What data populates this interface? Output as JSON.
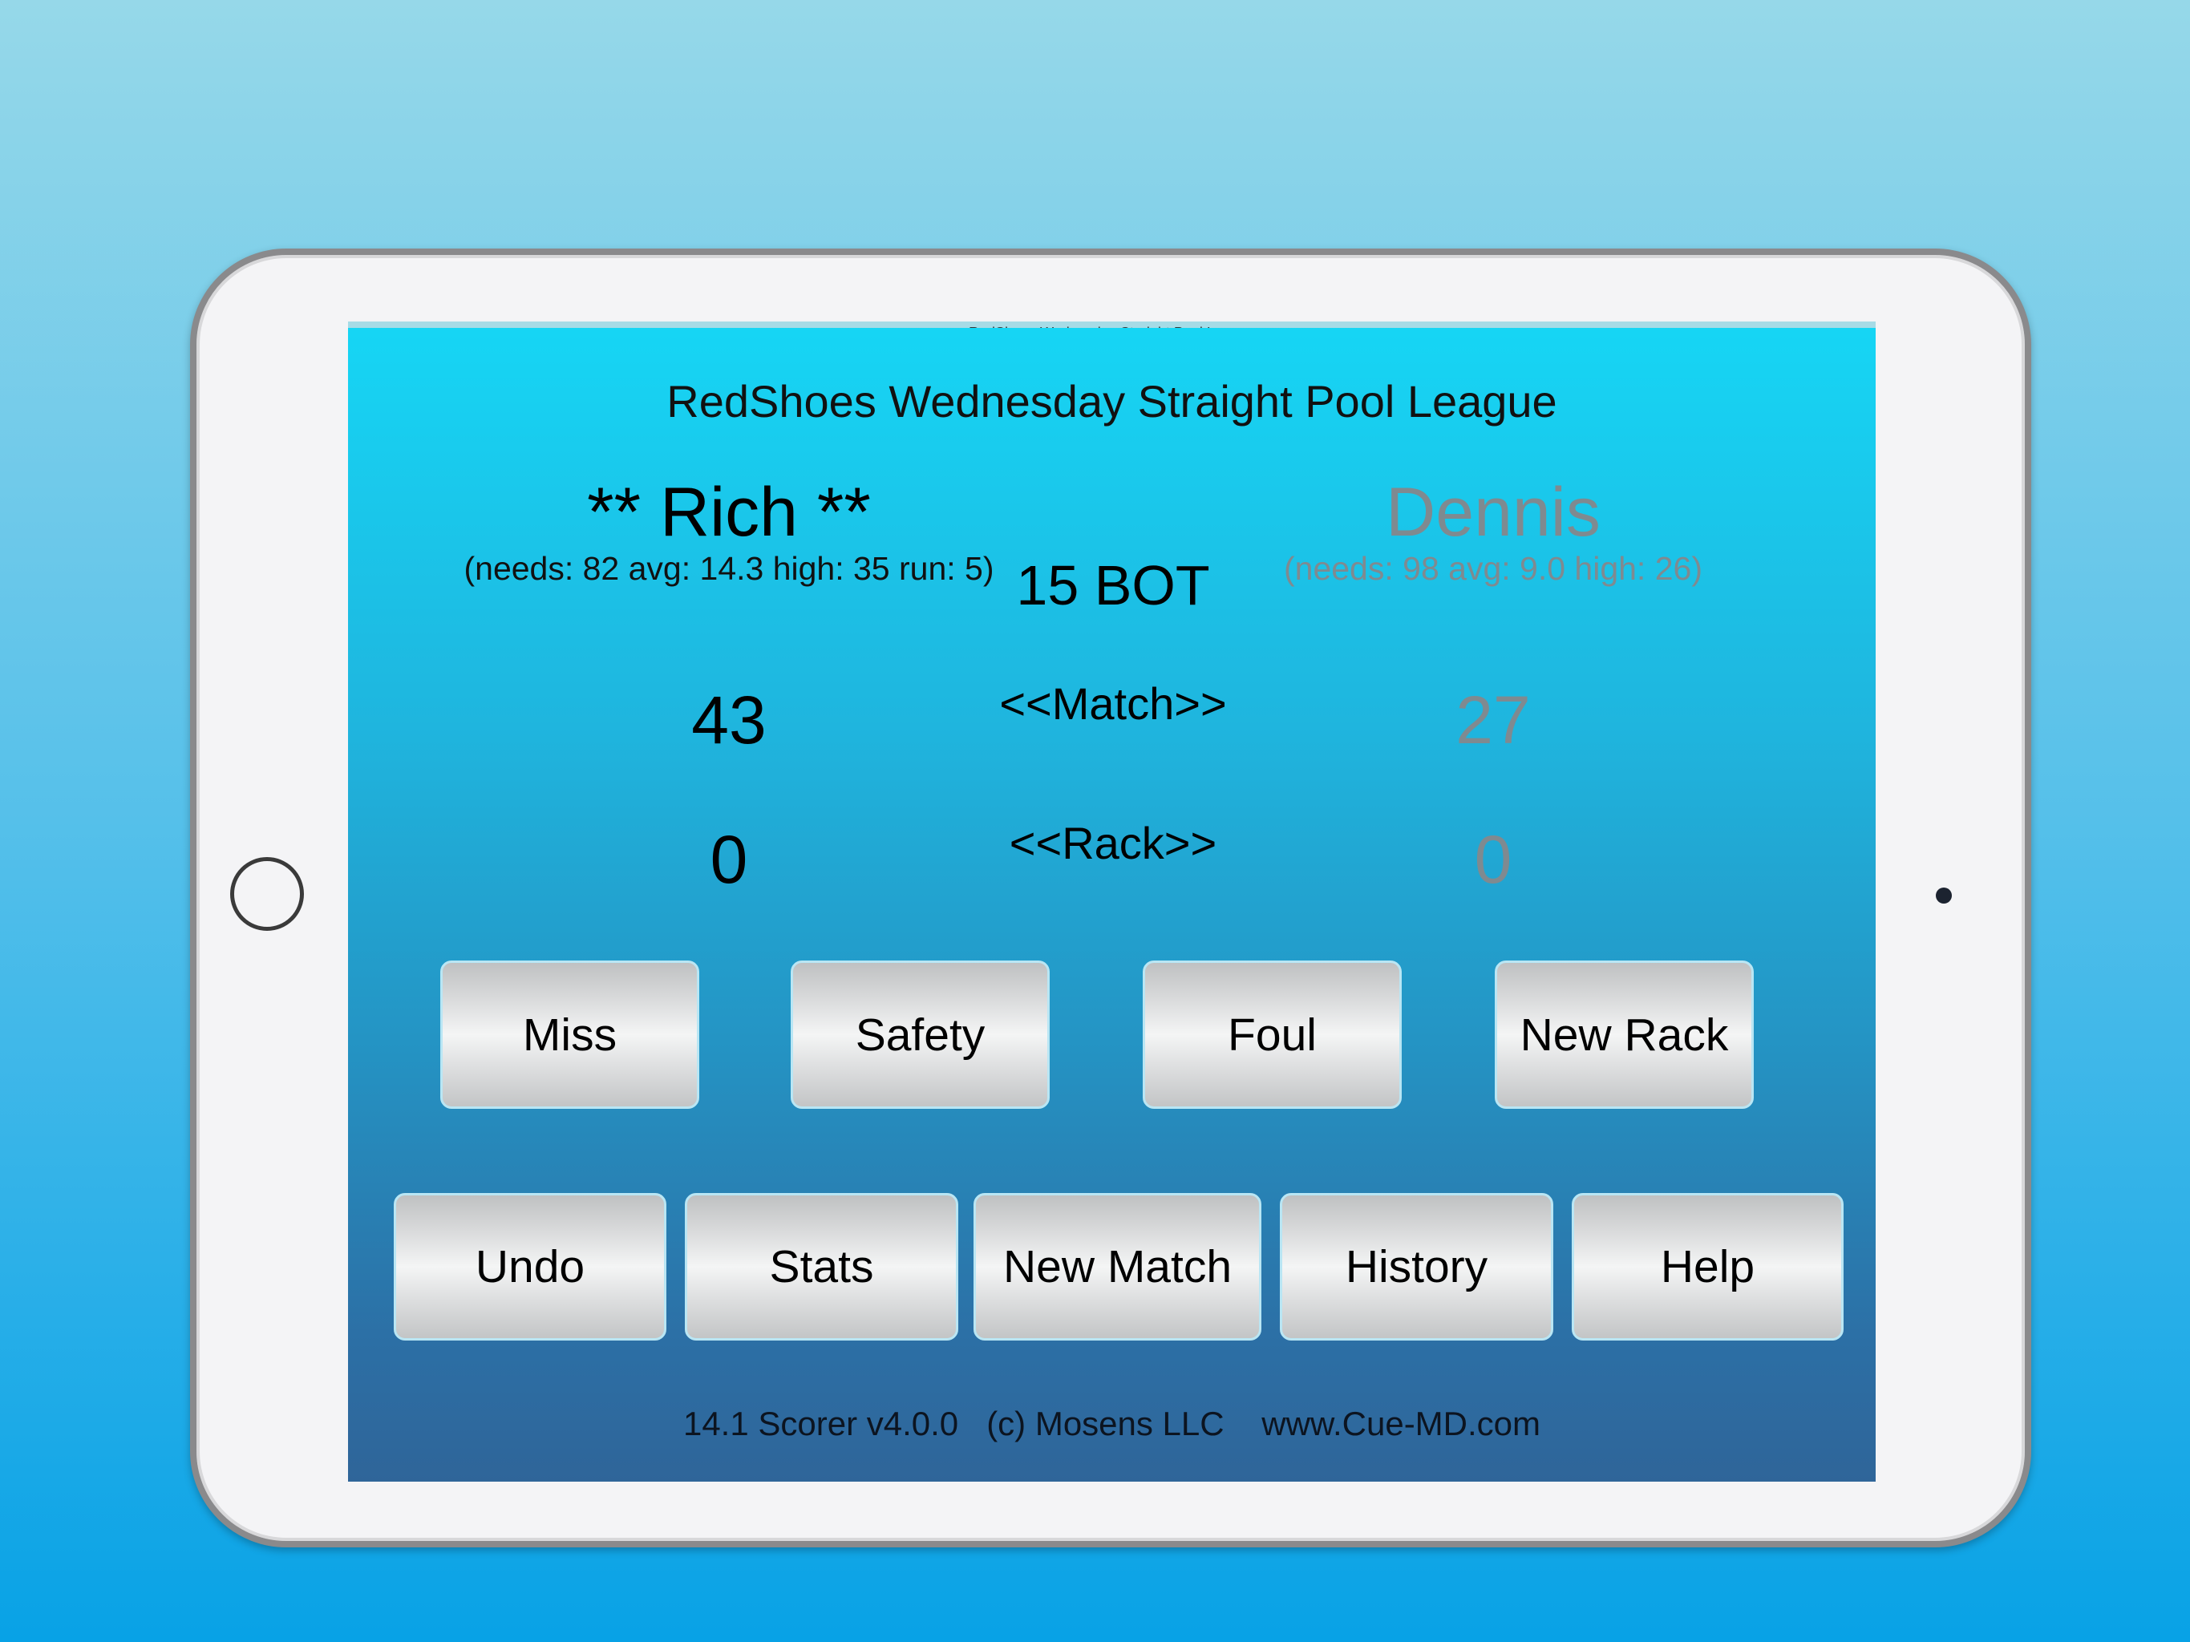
{
  "app": {
    "title": "RedShoes Wednesday Straight Pool League",
    "status_strip_text": "RedShoes Wednesday Straight Pool League"
  },
  "players": [
    {
      "name": "** Rich **",
      "stats": "(needs: 82 avg: 14.3 high: 35 run: 5)",
      "match_score": "43",
      "rack_score": "0",
      "active": true
    },
    {
      "name": "Dennis",
      "stats": "(needs: 98 avg: 9.0 high: 26)",
      "match_score": "27",
      "rack_score": "0",
      "active": false
    }
  ],
  "center": {
    "balls_on_table": "15 BOT",
    "match_label": "<<Match>>",
    "rack_label": "<<Rack>>"
  },
  "actions_row1": [
    "Miss",
    "Safety",
    "Foul",
    "New Rack"
  ],
  "actions_row2": [
    "Undo",
    "Stats",
    "New Match",
    "History",
    "Help"
  ],
  "footer": {
    "version": "14.1 Scorer v4.0.0",
    "copyright": "(c) Mosens LLC",
    "website": "www.Cue-MD.com"
  },
  "colors": {
    "active_player": "#000000",
    "inactive_player": "#7f8a90",
    "screen_top": "#16d6f5",
    "screen_bottom": "#2f6599"
  }
}
